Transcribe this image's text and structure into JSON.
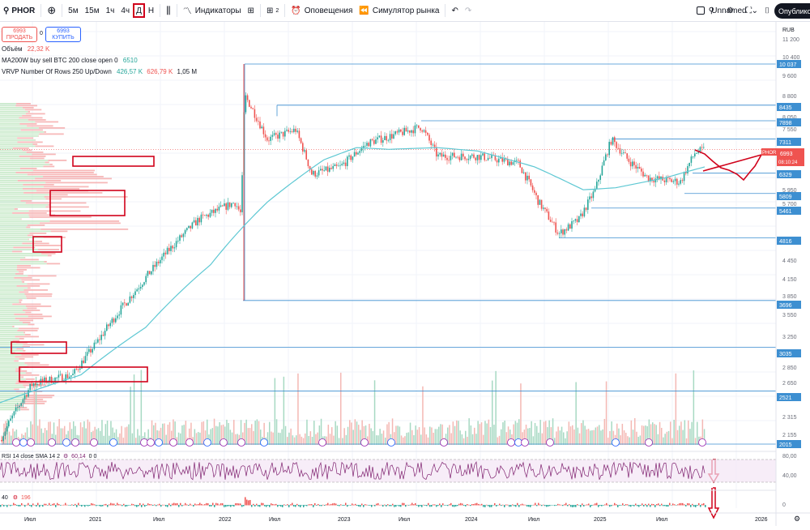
{
  "toolbar": {
    "symbol": "PHOR",
    "timeframes": [
      "5м",
      "15м",
      "1ч",
      "4ч",
      "Д",
      "Н"
    ],
    "active_timeframe": "Д",
    "indicators_label": "Индикаторы",
    "layouts_count": "2",
    "alerts_label": "Оповещения",
    "replay_label": "Симулятор рынка",
    "layout_name": "Unnamed",
    "publish_label": "Опубликовать"
  },
  "trade": {
    "sell_price": "6993",
    "sell_label": "ПРОДАТЬ",
    "spread": "0",
    "buy_price": "6993",
    "buy_label": "КУПИТЬ"
  },
  "legend": {
    "volume_label": "Объём",
    "volume_value": "22,32 K",
    "ma_label": "MA200W buy sell BTC 200 close open 0",
    "ma_value": "6510",
    "vrvp_label": "VRVP Number Of Rows 250 Up/Down",
    "vrvp_up": "426,57 K",
    "vrvp_down": "626,79 K",
    "vrvp_total": "1,05 M",
    "rsi_label": "RSI 14 close SMA 14 2",
    "rsi_value": "60,14",
    "rsi_extra": "0 0",
    "osc_label": "40",
    "osc_value": "196"
  },
  "price_axis": {
    "currency": "RUB",
    "ticks": [
      "11 200",
      "10 400",
      "9 600",
      "8 800",
      "8 050",
      "7 550",
      "6 550",
      "5 950",
      "5 700",
      "4 450",
      "4 150",
      "3 850",
      "3 550",
      "3 250",
      "2 850",
      "2 650",
      "2 315",
      "2 155"
    ],
    "levels": [
      "10 037",
      "8435",
      "7898",
      "7311",
      "6329",
      "5809",
      "5461",
      "4816",
      "3696",
      "3035",
      "2521",
      "2015"
    ],
    "current_symbol": "PHOR",
    "current_price": "6993",
    "countdown": "08:10:24",
    "rsi_ticks": [
      "80,00",
      "40,00"
    ],
    "osc_tick": "0"
  },
  "time_axis": {
    "labels": [
      "Июл",
      "2021",
      "Июл",
      "2022",
      "Июл",
      "2023",
      "Июл",
      "2024",
      "Июл",
      "2025",
      "Июл",
      "2026"
    ]
  },
  "colors": {
    "up": "#26a69a",
    "down": "#ef5350",
    "ma": "#5ec8d3",
    "level": "#3d8fd1",
    "annotation": "#d0021b",
    "rsi": "#7e1f6e"
  }
}
